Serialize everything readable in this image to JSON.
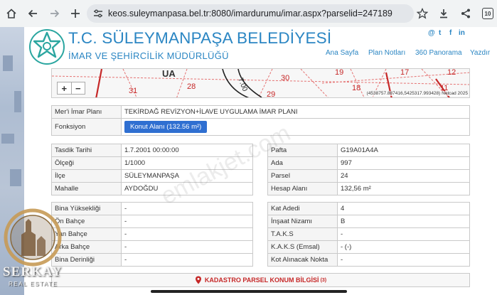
{
  "browser": {
    "url": "keos.suleymanpasa.bel.tr:8080/imardurumu/imar.aspx?parselid=247189",
    "tab_count": "10"
  },
  "header": {
    "title": "T.C. SÜLEYMANPAŞA BELEDİYESİ",
    "subtitle": "İMAR VE ŞEHİRCİLİK MÜDÜRLÜĞÜ",
    "social": [
      "@",
      "t",
      "f",
      "in"
    ],
    "nav": [
      "Ana Sayfa",
      "Plan Notları",
      "360 Panorama",
      "Yazdır"
    ]
  },
  "map": {
    "labels": [
      "UA",
      "31",
      "28",
      "7.00",
      "30",
      "29",
      "19",
      "18",
      "17",
      "12",
      "11"
    ],
    "zoom_in": "+",
    "zoom_out": "−",
    "attribution": "(4538757.887416,5425317.993428) Netcad 2025"
  },
  "plan": {
    "rows": [
      {
        "label": "Mer'i İmar Planı",
        "value": "TEKİRDAĞ REVİZYON+İLAVE UYGULAMA İMAR PLANI"
      },
      {
        "label": "Fonksiyon",
        "value": "Konut Alanı (132.56 m²)"
      }
    ]
  },
  "info_left": [
    {
      "label": "Tasdik Tarihi",
      "value": "1.7.2001 00:00:00"
    },
    {
      "label": "Ölçeği",
      "value": "1/1000"
    },
    {
      "label": "İlçe",
      "value": "SÜLEYMANPAŞA"
    },
    {
      "label": "Mahalle",
      "value": "AYDOĞDU"
    }
  ],
  "info_right": [
    {
      "label": "Pafta",
      "value": "G19A01A4A"
    },
    {
      "label": "Ada",
      "value": "997"
    },
    {
      "label": "Parsel",
      "value": "24"
    },
    {
      "label": "Hesap Alanı",
      "value": "132,56 m²"
    }
  ],
  "build_left": [
    {
      "label": "Bina Yüksekliği",
      "value": "-"
    },
    {
      "label": "Ön Bahçe",
      "value": "-"
    },
    {
      "label": "Yan Bahçe",
      "value": "-"
    },
    {
      "label": "Arka Bahçe",
      "value": "-"
    },
    {
      "label": "Bina Derinliği",
      "value": "-"
    }
  ],
  "build_right": [
    {
      "label": "Kat Adedi",
      "value": "4"
    },
    {
      "label": "İnşaat Nizamı",
      "value": "B"
    },
    {
      "label": "T.A.K.S",
      "value": "-"
    },
    {
      "label": "K.A.K.S (Emsal)",
      "value": "- (-)"
    },
    {
      "label": "Kot Alınacak Nokta",
      "value": "-"
    }
  ],
  "kadastro": {
    "title": "KADASTRO PARSEL KONUM BİLGİSİ",
    "sup": "(3)"
  },
  "watermark": "emlakjet.com",
  "overlay_brand": {
    "name": "SERKAY",
    "sub": "REAL ESTATE"
  },
  "colors": {
    "brand_blue": "#2b86c3",
    "button_blue": "#2f6fd1",
    "alert_red": "#c62828"
  }
}
